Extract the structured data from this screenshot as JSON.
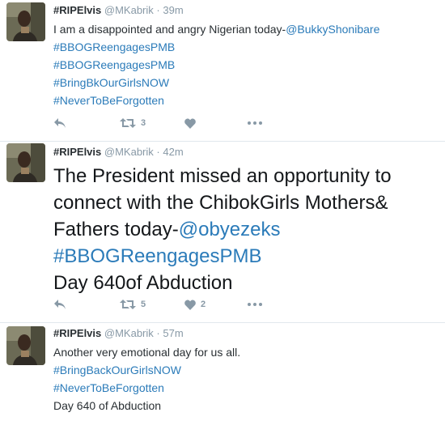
{
  "tweets": [
    {
      "name": "#RIPElvis",
      "handle": "@MKabrik",
      "separator": "·",
      "time": "39m",
      "lines": [
        [
          {
            "text": "I am a disappointed and angry Nigerian today-",
            "link": false
          },
          {
            "text": "@BukkyShonibare",
            "link": true
          }
        ],
        [
          {
            "text": "#BBOGReengagesPMB",
            "link": true
          }
        ],
        [
          {
            "text": "#BBOGReengagesPMB",
            "link": true
          }
        ],
        [
          {
            "text": "#BringBkOurGirlsNOW",
            "link": true
          }
        ],
        [
          {
            "text": "#NeverToBeForgotten",
            "link": true
          }
        ]
      ],
      "retweet_count": "3",
      "like_count": ""
    },
    {
      "name": "#RIPElvis",
      "handle": "@MKabrik",
      "separator": "·",
      "time": "42m",
      "lines": [
        [
          {
            "text": "The President missed an opportunity to",
            "link": false
          }
        ],
        [
          {
            "text": "connect with the ChibokGirls Mothers&",
            "link": false
          }
        ],
        [
          {
            "text": "Fathers today-",
            "link": false
          },
          {
            "text": "@obyezeks",
            "link": true
          }
        ],
        [
          {
            "text": "#BBOGReengagesPMB",
            "link": true
          }
        ],
        [
          {
            "text": "Day 640of Abduction",
            "link": false
          }
        ]
      ],
      "retweet_count": "5",
      "like_count": "2"
    },
    {
      "name": "#RIPElvis",
      "handle": "@MKabrik",
      "separator": "·",
      "time": "57m",
      "lines": [
        [
          {
            "text": "Another very emotional day for us all.",
            "link": false
          }
        ],
        [
          {
            "text": "#BringBackOurGirlsNOW",
            "link": true
          }
        ],
        [
          {
            "text": "#NeverToBeForgotten",
            "link": true
          }
        ],
        [
          {
            "text": "Day 640 of Abduction",
            "link": false
          }
        ]
      ]
    }
  ],
  "icons": {
    "reply": "reply-icon",
    "retweet": "retweet-icon",
    "like": "heart-icon",
    "more": "more-icon"
  },
  "colors": {
    "link": "#2b7bb9",
    "muted": "#8899a6",
    "text": "#292f33",
    "divider": "#e1e8ed"
  }
}
